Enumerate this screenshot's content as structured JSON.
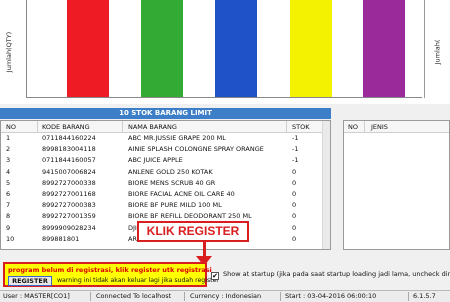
{
  "chart": {
    "left_axis_label": "Jumlah(QTY)",
    "right_axis_label": "Jumlah(",
    "bars": [
      {
        "color": "#ee1b24"
      },
      {
        "color": "#33aa33"
      },
      {
        "color": "#1f52c8"
      },
      {
        "color": "#f4f200"
      },
      {
        "color": "#9a2a9a"
      }
    ]
  },
  "panel": {
    "title": "10 STOK BARANG LIMIT",
    "columns": {
      "no": "NO",
      "kode": "KODE BARANG",
      "nama": "NAMA BARANG",
      "stok": "STOK"
    },
    "rows": [
      {
        "no": "1",
        "kode": "0711844160224",
        "nama": "ABC MR.JUSSIE GRAPE 200 ML",
        "stok": "-1"
      },
      {
        "no": "2",
        "kode": "8998183004118",
        "nama": "AINIE SPLASH COLONGNE SPRAY ORANGE",
        "stok": "-1"
      },
      {
        "no": "3",
        "kode": "0711844160057",
        "nama": "ABC JUICE APPLE",
        "stok": "-1"
      },
      {
        "no": "4",
        "kode": "9415007006824",
        "nama": "ANLENE GOLD 250 KOTAK",
        "stok": "0"
      },
      {
        "no": "5",
        "kode": "8992727000338",
        "nama": "BIORE MENS SCRUB 40 GR",
        "stok": "0"
      },
      {
        "no": "6",
        "kode": "8992727001168",
        "nama": "BIORE FACIAL ACNE OIL CARE 40",
        "stok": "0"
      },
      {
        "no": "7",
        "kode": "8992727000383",
        "nama": "BIORE BF PURE MILD 100 ML",
        "stok": "0"
      },
      {
        "no": "8",
        "kode": "8992727001359",
        "nama": "BIORE BF REFILL DEODORANT 250 ML",
        "stok": "0"
      },
      {
        "no": "9",
        "kode": "8999909028234",
        "nama": "DJI",
        "stok": "0"
      },
      {
        "no": "10",
        "kode": "899881801",
        "nama": "ARI",
        "stok": "0"
      }
    ]
  },
  "right_panel": {
    "columns": {
      "no": "NO",
      "jenis": "JENIS"
    }
  },
  "overlay": {
    "label": "KLIK REGISTER"
  },
  "warning": {
    "line1": "program belum di registrasi, klik register utk registrasi",
    "button": "REGISTER",
    "line2": "warning ini tidak akan keluar lagi jika sudah register"
  },
  "startup": {
    "checked": true,
    "label": "Show at startup (jika pada saat startup loading jadi lama, uncheck direkomendasikan)"
  },
  "status": {
    "user": "User : MASTER[CO1]",
    "connection": "Connected To localhost",
    "currency": "Currency : Indonesian",
    "start": "Start   : 03-04-2016 06:00:10",
    "version": "6.1.5.7"
  }
}
